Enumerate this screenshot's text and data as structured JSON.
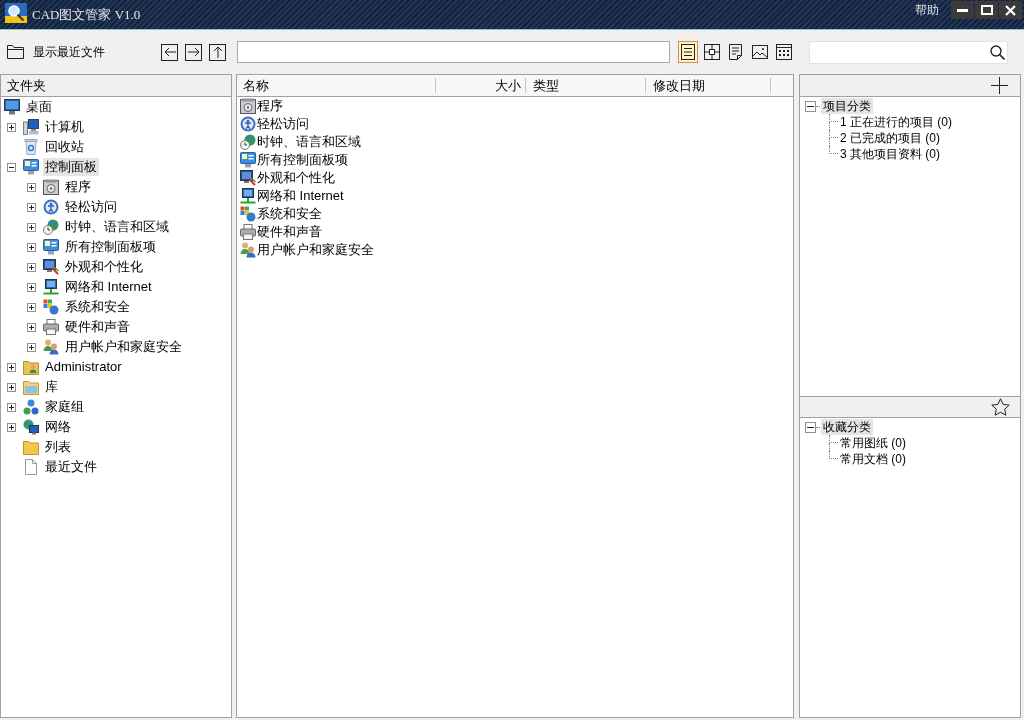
{
  "window": {
    "title": "CAD图文管家 V1.0",
    "menu": [
      "帮助"
    ]
  },
  "toolbar": {
    "recent_files": "显示最近文件",
    "view_modes": [
      {
        "selected": true
      },
      {
        "selected": false
      },
      {
        "selected": false
      },
      {
        "selected": false
      },
      {
        "selected": false
      }
    ]
  },
  "folder_panel": {
    "title": "文件夹",
    "tree": [
      {
        "label": "桌面",
        "kind": "desktop",
        "selected": false,
        "children": [
          {
            "label": "计算机",
            "kind": "computer",
            "expanded": false,
            "selected": false
          },
          {
            "label": "回收站",
            "kind": "recycle-bin",
            "selected": false
          },
          {
            "label": "控制面板",
            "kind": "control-panel",
            "expanded": true,
            "selected": true,
            "children": [
              {
                "label": "程序",
                "kind": "programs",
                "expanded": false,
                "selected": false
              },
              {
                "label": "轻松访问",
                "kind": "accessibility",
                "expanded": false,
                "selected": false
              },
              {
                "label": "时钟、语言和区域",
                "kind": "clock-region",
                "expanded": false,
                "selected": false
              },
              {
                "label": "所有控制面板项",
                "kind": "control-panel",
                "expanded": false,
                "selected": false
              },
              {
                "label": "外观和个性化",
                "kind": "appearance",
                "expanded": false,
                "selected": false
              },
              {
                "label": "网络和 Internet",
                "kind": "network-internet",
                "expanded": false,
                "selected": false
              },
              {
                "label": "系统和安全",
                "kind": "security",
                "expanded": false,
                "selected": false
              },
              {
                "label": "硬件和声音",
                "kind": "hardware",
                "expanded": false,
                "selected": false
              },
              {
                "label": "用户帐户和家庭安全",
                "kind": "user-accounts",
                "expanded": false,
                "selected": false
              }
            ]
          },
          {
            "label": "Administrator",
            "kind": "user-folder",
            "expanded": false,
            "selected": false
          },
          {
            "label": "库",
            "kind": "library",
            "expanded": false,
            "selected": false
          },
          {
            "label": "家庭组",
            "kind": "homegroup",
            "expanded": false,
            "selected": false
          },
          {
            "label": "网络",
            "kind": "network",
            "expanded": false,
            "selected": false
          },
          {
            "label": "列表",
            "kind": "folder",
            "selected": false
          },
          {
            "label": "最近文件",
            "kind": "file",
            "selected": false
          }
        ]
      }
    ]
  },
  "file_list": {
    "columns": [
      "名称",
      "大小",
      "类型",
      "修改日期"
    ],
    "rows": [
      {
        "name": "程序",
        "kind": "programs"
      },
      {
        "name": "轻松访问",
        "kind": "accessibility"
      },
      {
        "name": "时钟、语言和区域",
        "kind": "clock-region"
      },
      {
        "name": "所有控制面板项",
        "kind": "control-panel"
      },
      {
        "name": "外观和个性化",
        "kind": "appearance"
      },
      {
        "name": "网络和 Internet",
        "kind": "network-internet"
      },
      {
        "name": "系统和安全",
        "kind": "security"
      },
      {
        "name": "硬件和声音",
        "kind": "hardware"
      },
      {
        "name": "用户帐户和家庭安全",
        "kind": "user-accounts"
      }
    ]
  },
  "project_panel": {
    "tree": [
      {
        "label": "项目分类",
        "expanded": true,
        "selected": true,
        "children": [
          {
            "label": "1 正在进行的项目 (0)",
            "selected": false
          },
          {
            "label": "2 已完成的项目 (0)",
            "selected": false
          },
          {
            "label": "3 其他项目资料 (0)",
            "selected": false
          }
        ]
      }
    ]
  },
  "favorites_panel": {
    "tree": [
      {
        "label": "收藏分类",
        "expanded": true,
        "selected": true,
        "children": [
          {
            "label": "常用图纸 (0)",
            "selected": false
          },
          {
            "label": "常用文档 (0)",
            "selected": false
          }
        ]
      }
    ]
  }
}
